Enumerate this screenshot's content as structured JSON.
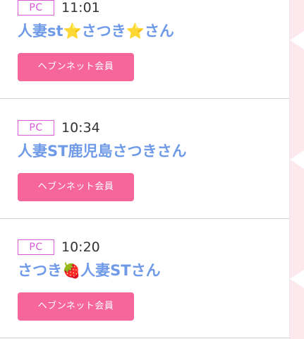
{
  "entries": [
    {
      "platform": "PC",
      "time": "11:01",
      "name": "人妻st⭐さつき⭐さん",
      "badge": "ヘブンネット会員"
    },
    {
      "platform": "PC",
      "time": "10:34",
      "name": "人妻ST鹿児島さつきさん",
      "badge": "ヘブンネット会員"
    },
    {
      "platform": "PC",
      "time": "10:20",
      "name": "さつき🍓人妻STさん",
      "badge": "ヘブンネット会員"
    }
  ],
  "colors": {
    "platform_badge": "#d659d6",
    "name_text": "#6f9ae8",
    "member_badge": "#f7669a",
    "side_strip": "#fde8ed"
  }
}
